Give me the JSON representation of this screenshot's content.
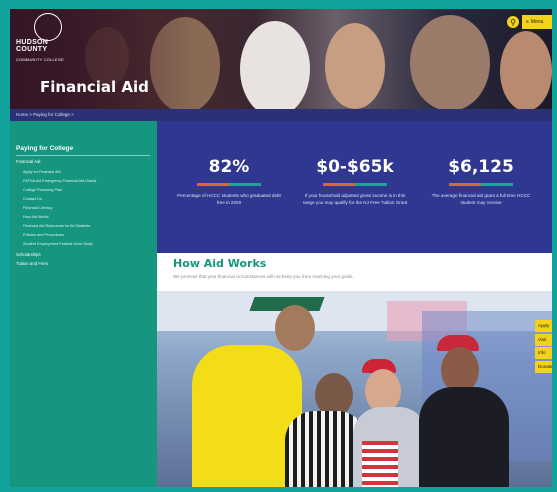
{
  "header": {
    "logo_line1": "HUDSON COUNTY",
    "logo_line2": "COMMUNITY COLLEGE",
    "page_title": "Financial Aid",
    "menu_label": "Menu"
  },
  "breadcrumb": "Home  >  Paying for College  >",
  "sidebar": {
    "heading": "Paying for College",
    "top_item": "Financial Aid",
    "items": [
      "Apply for Financial Aid",
      "FAFSA Aid Emergency Financial Aid Grants",
      "College Financing Plan",
      "Contact Us",
      "Financial Literacy",
      "How Aid Works",
      "Financial Aid Resources for All Students",
      "Policies and Procedures",
      "Student Employment Federal Work Study"
    ],
    "extra_items": [
      "Scholarships",
      "Tuition and Fees"
    ]
  },
  "stats": [
    {
      "value": "82%",
      "desc": "Percentage of HCCC students who graduated debt free in 2020"
    },
    {
      "value": "$0-$65k",
      "desc": "If your household adjusted gross income is in this range you may qualify for the NJ Free Tuition Grant"
    },
    {
      "value": "$6,125",
      "desc": "The average financial aid grant a full time HCCC student may receive"
    }
  ],
  "how_aid": {
    "title": "How Aid Works",
    "subtitle": "We promise that your financial circumstances will not keep you from reaching your goals."
  },
  "side_tabs": [
    "Apply",
    "Visit",
    "Info",
    "Donate"
  ],
  "colors": {
    "teal": "#16957f",
    "navy": "#2f3790",
    "yellow": "#f3d21b",
    "orange": "#d96a2b"
  }
}
